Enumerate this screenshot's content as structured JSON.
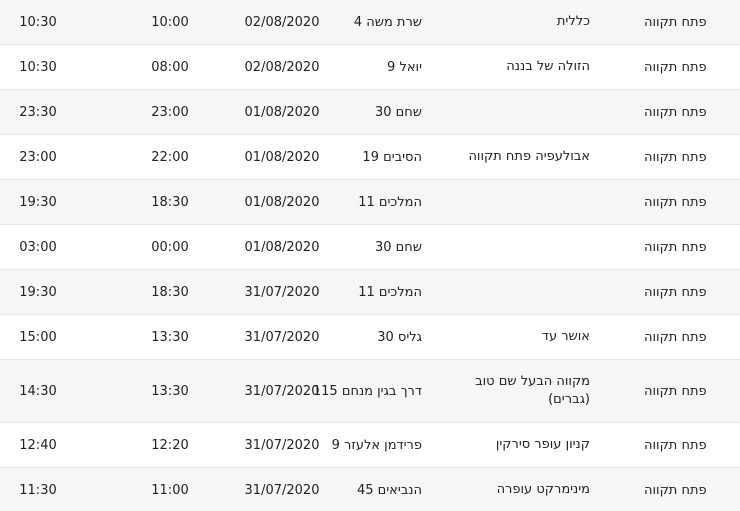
{
  "rows": [
    {
      "city": "פתח תקווה",
      "place": "כללית",
      "address": "שרת משה 4",
      "date": "02/08/2020",
      "start": "10:00",
      "end": "10:30"
    },
    {
      "city": "פתח תקווה",
      "place": "הזולה של בננה",
      "address": "יואל 9",
      "date": "02/08/2020",
      "start": "08:00",
      "end": "10:30"
    },
    {
      "city": "פתח תקווה",
      "place": "",
      "address": "שחם 30",
      "date": "01/08/2020",
      "start": "23:00",
      "end": "23:30"
    },
    {
      "city": "פתח תקווה",
      "place": "אבולעפיה פתח תקווה",
      "address": "הסיבים 19",
      "date": "01/08/2020",
      "start": "22:00",
      "end": "23:00"
    },
    {
      "city": "פתח תקווה",
      "place": "",
      "address": "המלכים 11",
      "date": "01/08/2020",
      "start": "18:30",
      "end": "19:30"
    },
    {
      "city": "פתח תקווה",
      "place": "",
      "address": "שחם 30",
      "date": "01/08/2020",
      "start": "00:00",
      "end": "03:00"
    },
    {
      "city": "פתח תקווה",
      "place": "",
      "address": "המלכים 11",
      "date": "31/07/2020",
      "start": "18:30",
      "end": "19:30"
    },
    {
      "city": "פתח תקווה",
      "place": "אושר עד",
      "address": "גליס 30",
      "date": "31/07/2020",
      "start": "13:30",
      "end": "15:00"
    },
    {
      "city": "פתח תקווה",
      "place": "מקווה הבעל שם טוב (גברים)",
      "address": "דרך בגין מנחם 115",
      "date": "31/07/2020",
      "start": "13:30",
      "end": "14:30"
    },
    {
      "city": "פתח תקווה",
      "place": "קניון עופר סירקין",
      "address": "פרידמן אלעזר 9",
      "date": "31/07/2020",
      "start": "12:20",
      "end": "12:40"
    },
    {
      "city": "פתח תקווה",
      "place": "מינימרקט עופרה",
      "address": "הנביאים 45",
      "date": "31/07/2020",
      "start": "11:00",
      "end": "11:30"
    }
  ]
}
